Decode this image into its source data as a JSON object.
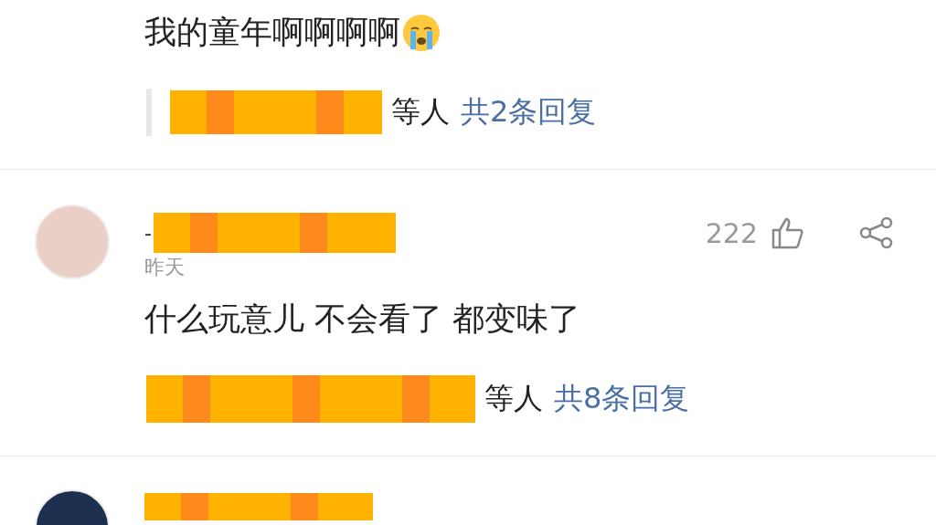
{
  "comments": [
    {
      "kind": "full",
      "text": "我的童年啊啊啊啊",
      "emoji": true,
      "replies": {
        "suffix": "等人",
        "count": "共2条回复"
      }
    },
    {
      "kind": "full",
      "avatar": true,
      "username_prefix": "-",
      "time": "昨天",
      "likes": "222",
      "text": "什么玩意儿 不会看了 都变味了",
      "replies": {
        "suffix": "等人",
        "count": "共8条回复"
      }
    },
    {
      "kind": "cut",
      "avatar": true
    }
  ]
}
